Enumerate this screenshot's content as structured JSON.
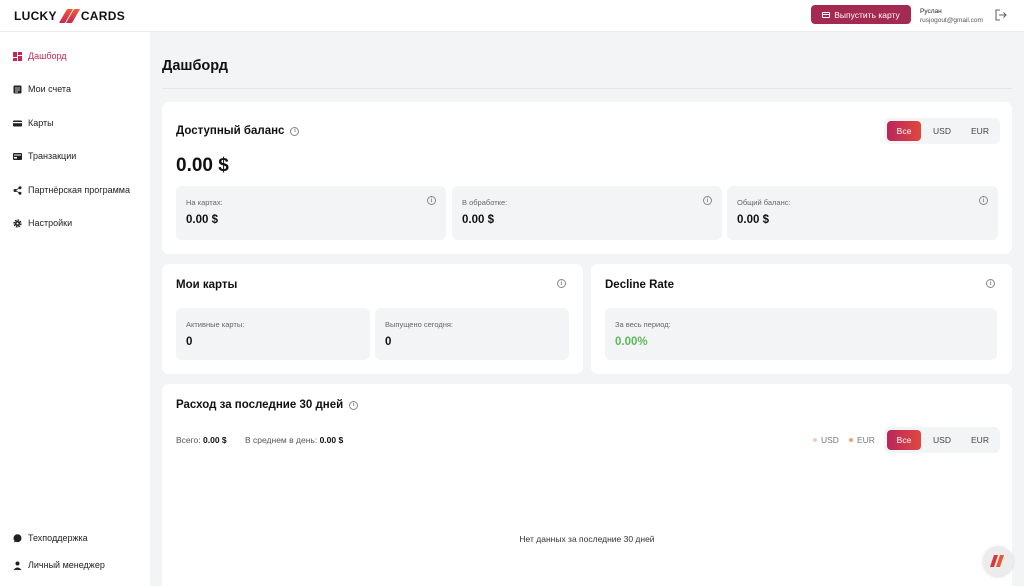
{
  "header": {
    "logo_left": "LUCKY",
    "logo_right": "CARDS",
    "issue_button": "Выпустить карту",
    "user_name": "Руслан",
    "user_email": "rusjogout@gmail.com"
  },
  "sidebar": {
    "items": [
      {
        "label": "Дашборд",
        "icon": "dashboard-icon",
        "active": true
      },
      {
        "label": "Мои счета",
        "icon": "accounts-icon"
      },
      {
        "label": "Карты",
        "icon": "card-icon"
      },
      {
        "label": "Транзакции",
        "icon": "transactions-icon"
      },
      {
        "label": "Партнёрская программа",
        "icon": "share-icon"
      },
      {
        "label": "Настройки",
        "icon": "gear-icon"
      }
    ],
    "bottom": [
      {
        "label": "Техподдержка",
        "icon": "chat-icon"
      },
      {
        "label": "Личный менеджер",
        "icon": "user-icon"
      }
    ]
  },
  "page_title": "Дашборд",
  "balance": {
    "title": "Доступный баланс",
    "total": "0.00 $",
    "currency_options": [
      "Все",
      "USD",
      "EUR"
    ],
    "selected_currency": "Все",
    "tiles": [
      {
        "label": "На картах:",
        "value": "0.00 $"
      },
      {
        "label": "В обработке:",
        "value": "0.00 $"
      },
      {
        "label": "Общий баланс:",
        "value": "0.00 $"
      }
    ]
  },
  "my_cards": {
    "title": "Мои карты",
    "tiles": [
      {
        "label": "Активные карты:",
        "value": "0"
      },
      {
        "label": "Выпущено сегодня:",
        "value": "0"
      }
    ]
  },
  "decline_rate": {
    "title": "Decline Rate",
    "tile_label": "За весь период:",
    "tile_value": "0.00%",
    "value_color": "#5cb85c"
  },
  "spending": {
    "title": "Расход за последние 30 дней",
    "total_label": "Всего:",
    "total_value": "0.00 $",
    "avg_label": "В среднем в день:",
    "avg_value": "0.00 $",
    "legend": [
      {
        "name": "USD",
        "color": "#f4c9c0"
      },
      {
        "name": "EUR",
        "color": "#f2a27a"
      }
    ],
    "currency_options": [
      "Все",
      "USD",
      "EUR"
    ],
    "selected_currency": "Все",
    "empty_message": "Нет данных за последние 30 дней"
  },
  "colors": {
    "accent": "#c8264f",
    "button": "#a52a4f"
  }
}
